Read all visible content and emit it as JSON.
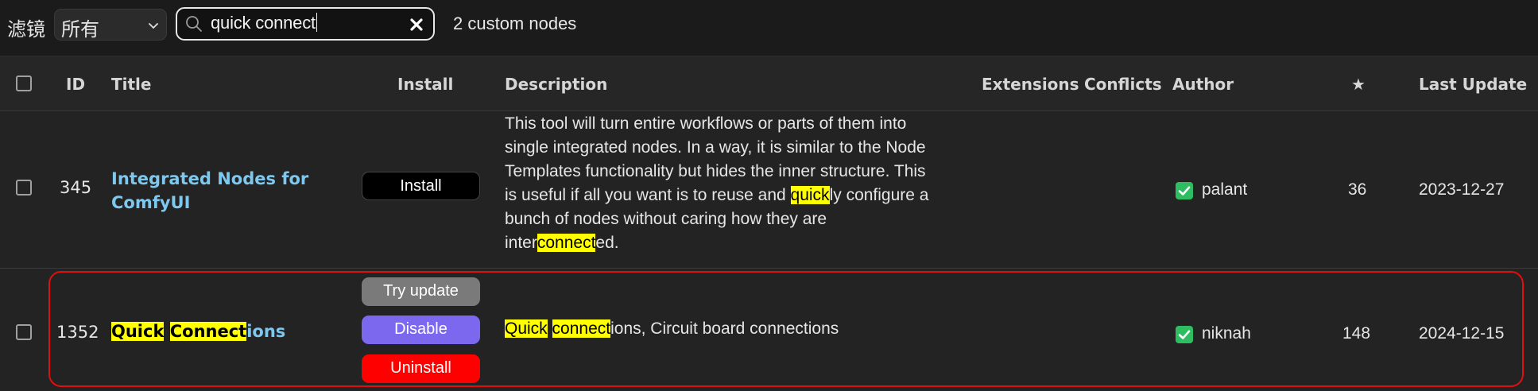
{
  "toolbar": {
    "filter_label": "滤镜",
    "filter_value": "所有",
    "search_value": "quick connect",
    "result_count": "2 custom nodes"
  },
  "columns": {
    "id": "ID",
    "title": "Title",
    "install": "Install",
    "description": "Description",
    "extensions": "Extensions",
    "conflicts": "Conflicts",
    "author": "Author",
    "stars": "★",
    "last_update": "Last Update"
  },
  "rows": [
    {
      "id": "345",
      "title_lines": [
        "Integrated Nodes for",
        "ComfyUI"
      ],
      "buttons": [
        "Install"
      ],
      "description_lines": [
        "This tool will turn entire workflows or parts of them into",
        "single integrated nodes. In a way, it is similar to the Node",
        "Templates functionality but hides the inner structure. This",
        "is useful if all you want is to reuse and quickly configure a",
        "bunch of nodes without caring how they are",
        "interconnected."
      ],
      "author": "palant",
      "stars": "36",
      "last_update": "2023-12-27"
    },
    {
      "id": "1352",
      "title": "Quick Connections",
      "buttons": [
        "Try update",
        "Disable",
        "Uninstall"
      ],
      "description": "Quick connections, Circuit board connections",
      "author": "niknah",
      "stars": "148",
      "last_update": "2024-12-15"
    }
  ],
  "colors": {
    "highlight": "#ffff00",
    "title_link": "#7ec8f0",
    "install_button": "#000000",
    "try_update_button": "#7a7a7a",
    "disable_button": "#7b68ee",
    "uninstall_button": "#ff0000",
    "check_green": "#2ebd60",
    "selection_outline": "#e01010"
  },
  "icons": {
    "filter_dropdown": "chevron-down-icon",
    "search": "search-icon",
    "clear_search": "close-icon",
    "author_check": "checkmark-icon"
  }
}
